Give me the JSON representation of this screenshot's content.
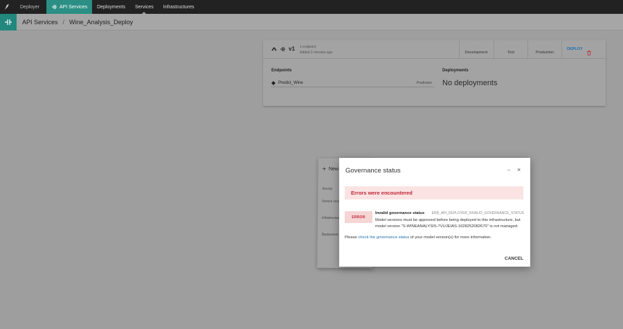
{
  "topnav": {
    "deployer": "Deployer",
    "items": [
      "API Services",
      "Deployments",
      "Services",
      "Infrastructures"
    ]
  },
  "breadcrumb": {
    "root": "API Services",
    "separator": "/",
    "current": "Wine_Analysis_Deploy"
  },
  "version_card": {
    "version": "v1",
    "endpoint_count": "1 endpoint",
    "added": "Added 2 minutes ago",
    "stages": [
      {
        "dots": "...",
        "name": "Development"
      },
      {
        "dots": "...",
        "name": "Test"
      },
      {
        "dots": "...",
        "name": "Production"
      }
    ],
    "deploy_label": "DEPLOY",
    "endpoints_title": "Endpoints",
    "endpoint": {
      "name": "Predict_Wine",
      "type": "Prediction"
    },
    "deployments_title": "Deployments",
    "no_deployments": "No deployments"
  },
  "background_panel": {
    "title": "New",
    "labels": [
      "Service",
      "Service versio",
      "Infrastructure",
      "Deployment I"
    ]
  },
  "modal": {
    "title": "Governance status",
    "min": "–",
    "close": "×",
    "error_banner": "Errors were encountered",
    "badge": "ERROR",
    "error_title": "Invalid governance status",
    "error_code": "ERR_API_DEPLOYER_INVALID_GOVERNANCE_STATUS",
    "error_message": "Model versions must be approved before being deployed to this infrastructure, but model version \"S-WINEANALYSIS-7VUJEIAS-1628252082670\" is not managed.",
    "please_prefix": "Please ",
    "please_link": "check the governance status",
    "please_suffix": " of your model version(s) for more information.",
    "cancel": "CANCEL"
  },
  "colors": {
    "accent": "#2b8f85",
    "error": "#c0273a",
    "link": "#1d6fb0"
  }
}
